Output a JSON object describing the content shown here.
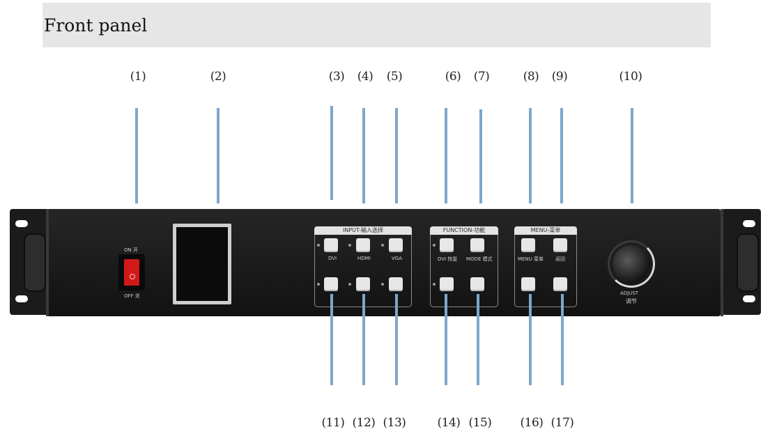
{
  "header": {
    "title": "Front panel"
  },
  "callouts": {
    "c1": "(1)",
    "c2": "(2)",
    "c3": "(3)",
    "c4": "(4)",
    "c5": "(5)",
    "c6": "(6)",
    "c7": "(7)",
    "c8": "(8)",
    "c9": "(9)",
    "c10": "(10)",
    "c11": "(11)",
    "c12": "(12)",
    "c13": "(13)",
    "c14": "(14)",
    "c15": "(15)",
    "c16": "(16)",
    "c17": "(17)"
  },
  "panel": {
    "power_on": "ON 开",
    "power_off": "OFF 关",
    "input_group": "INPUT-输入选择",
    "function_group": "FUNCTION-功能",
    "menu_group": "MENU-菜单",
    "adjust_label": "ADJUST",
    "adjust_cn": "调节",
    "btn_dvi": "DVI",
    "btn_hdmi": "HDMI",
    "btn_vga": "VGA",
    "btn_dvi_restore": "DVI 恢复",
    "btn_mode": "MODE 模式",
    "btn_menu": "MENU 菜单",
    "btn_back": "返回"
  },
  "colors": {
    "leader_line": "#7ea6cc",
    "header_bar": "#e6e6e6",
    "power_switch": "#d21919"
  }
}
